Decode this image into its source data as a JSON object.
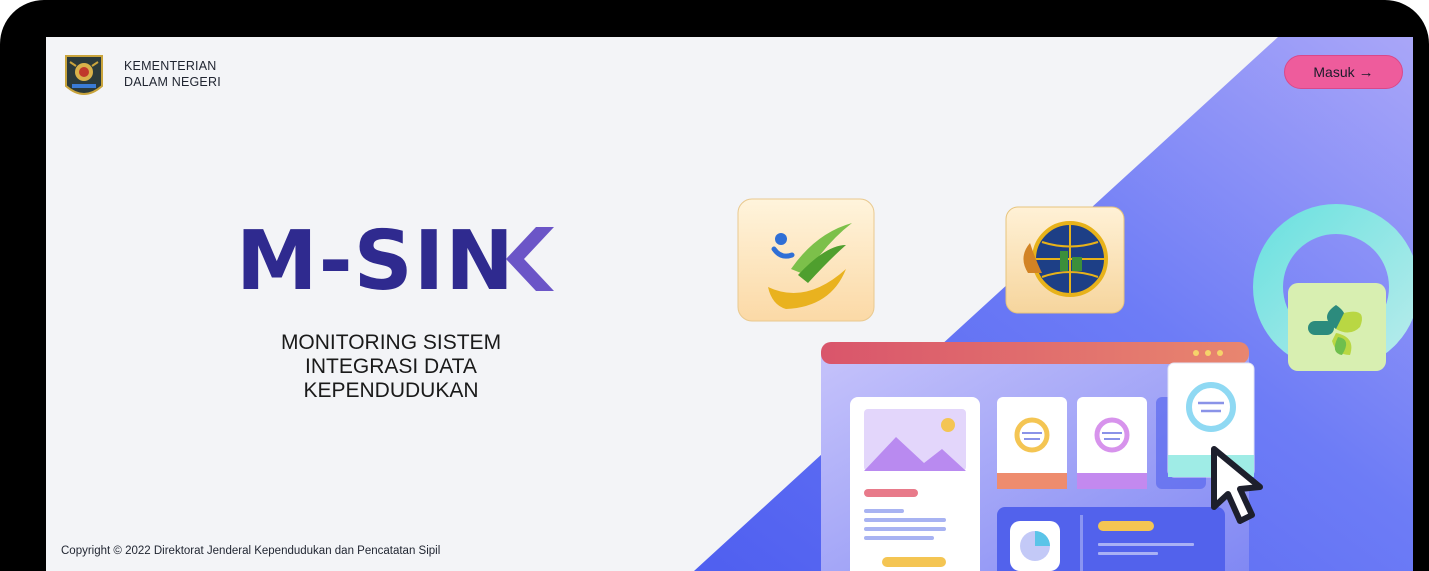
{
  "header": {
    "ministry_line1": "KEMENTERIAN",
    "ministry_line2": "DALAM NEGERI",
    "login_label": "Masuk",
    "login_arrow": "→"
  },
  "hero": {
    "brand": "M-SINK",
    "subtitle_line1": "MONITORING SISTEM",
    "subtitle_line2": "INTEGRASI DATA",
    "subtitle_line3": "KEPENDUDUKAN"
  },
  "footer": {
    "copyright": "Copyright © 2022 Direktorat Jenderal Kependudukan dan Pencatatan Sipil"
  },
  "colors": {
    "brand_navy": "#2f2a8f",
    "brand_purple": "#6b55c7",
    "login_bg": "#ee5c9c",
    "diagonal_blue": "#5a6af0"
  },
  "icons": {
    "emblem": "kemendagri-emblem-icon",
    "tile1": "ministry-of-agriculture-logo",
    "tile2": "land-agency-globe-logo",
    "tile3": "health-ministry-logo",
    "cursor": "mouse-pointer-icon"
  }
}
